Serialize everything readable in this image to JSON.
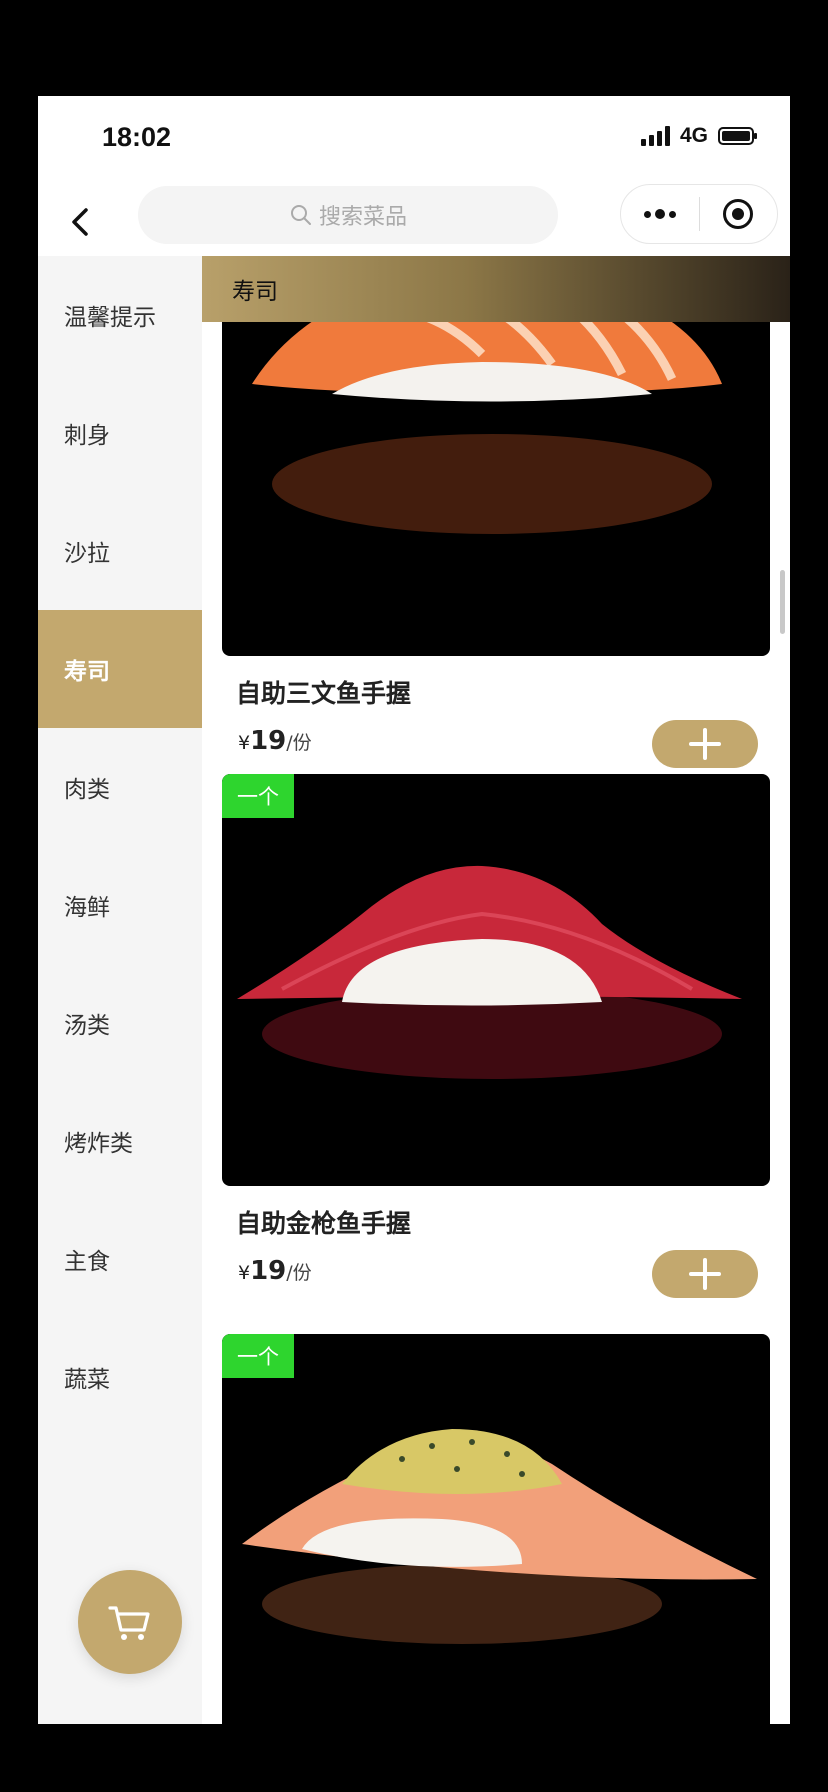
{
  "status_bar": {
    "time": "18:02",
    "network": "4G"
  },
  "search": {
    "placeholder": "搜索菜品"
  },
  "sidebar": {
    "items": [
      {
        "label": "温馨提示"
      },
      {
        "label": "刺身"
      },
      {
        "label": "沙拉"
      },
      {
        "label": "寿司",
        "active": true
      },
      {
        "label": "肉类"
      },
      {
        "label": "海鲜"
      },
      {
        "label": "汤类"
      },
      {
        "label": "烤炸类"
      },
      {
        "label": "主食"
      },
      {
        "label": "蔬菜"
      }
    ]
  },
  "section": {
    "title": "寿司"
  },
  "products": [
    {
      "name": "自助三文鱼手握",
      "currency": "¥",
      "price": "19",
      "unit": "/份",
      "tag": "",
      "fish_color": "#f07a3c"
    },
    {
      "name": "自助金枪鱼手握",
      "currency": "¥",
      "price": "19",
      "unit": "/份",
      "tag": "一个",
      "fish_color": "#c8283a"
    },
    {
      "name": "",
      "currency": "",
      "price": "",
      "unit": "",
      "tag": "一个",
      "fish_color": "#f2a07a"
    }
  ],
  "colors": {
    "accent": "#c3a86e",
    "tag": "#2ed52e"
  }
}
